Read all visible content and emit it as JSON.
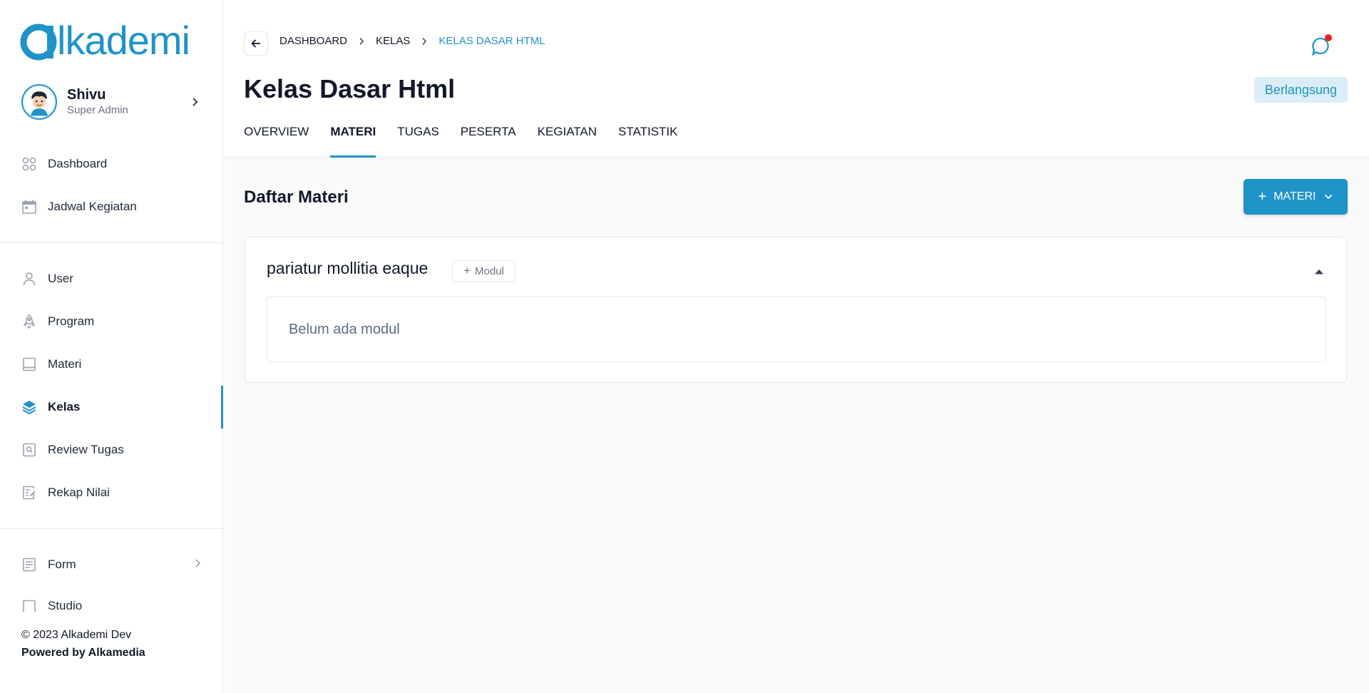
{
  "brand": {
    "logo_text": "lkademi",
    "accent": "#1f93c8"
  },
  "user": {
    "name": "Shivu",
    "role": "Super Admin"
  },
  "sidebar": {
    "items": [
      {
        "label": "Dashboard",
        "icon": "grid-icon"
      },
      {
        "label": "Jadwal Kegiatan",
        "icon": "calendar-icon"
      },
      {
        "label": "User",
        "icon": "user-icon"
      },
      {
        "label": "Program",
        "icon": "rocket-icon"
      },
      {
        "label": "Materi",
        "icon": "book-icon"
      },
      {
        "label": "Kelas",
        "icon": "layers-icon",
        "active": true
      },
      {
        "label": "Review Tugas",
        "icon": "review-icon"
      },
      {
        "label": "Rekap Nilai",
        "icon": "edit-note-icon"
      },
      {
        "label": "Form",
        "icon": "form-icon"
      },
      {
        "label": "Studio",
        "icon": "studio-icon"
      }
    ]
  },
  "footer": {
    "copyright": "© 2023 Alkademi Dev",
    "powered": "Powered by Alkamedia"
  },
  "breadcrumb": [
    "DASHBOARD",
    "KELAS",
    "KELAS DASAR HTML"
  ],
  "page": {
    "title": "Kelas Dasar Html",
    "status": "Berlangsung"
  },
  "tabs": [
    "OVERVIEW",
    "MATERI",
    "TUGAS",
    "PESERTA",
    "KEGIATAN",
    "STATISTIK"
  ],
  "active_tab": "MATERI",
  "materi": {
    "heading": "Daftar Materi",
    "add_button": "MATERI",
    "sections": [
      {
        "title": "pariatur mollitia eaque",
        "add_modul_label": "Modul",
        "empty_text": "Belum ada modul"
      }
    ]
  }
}
